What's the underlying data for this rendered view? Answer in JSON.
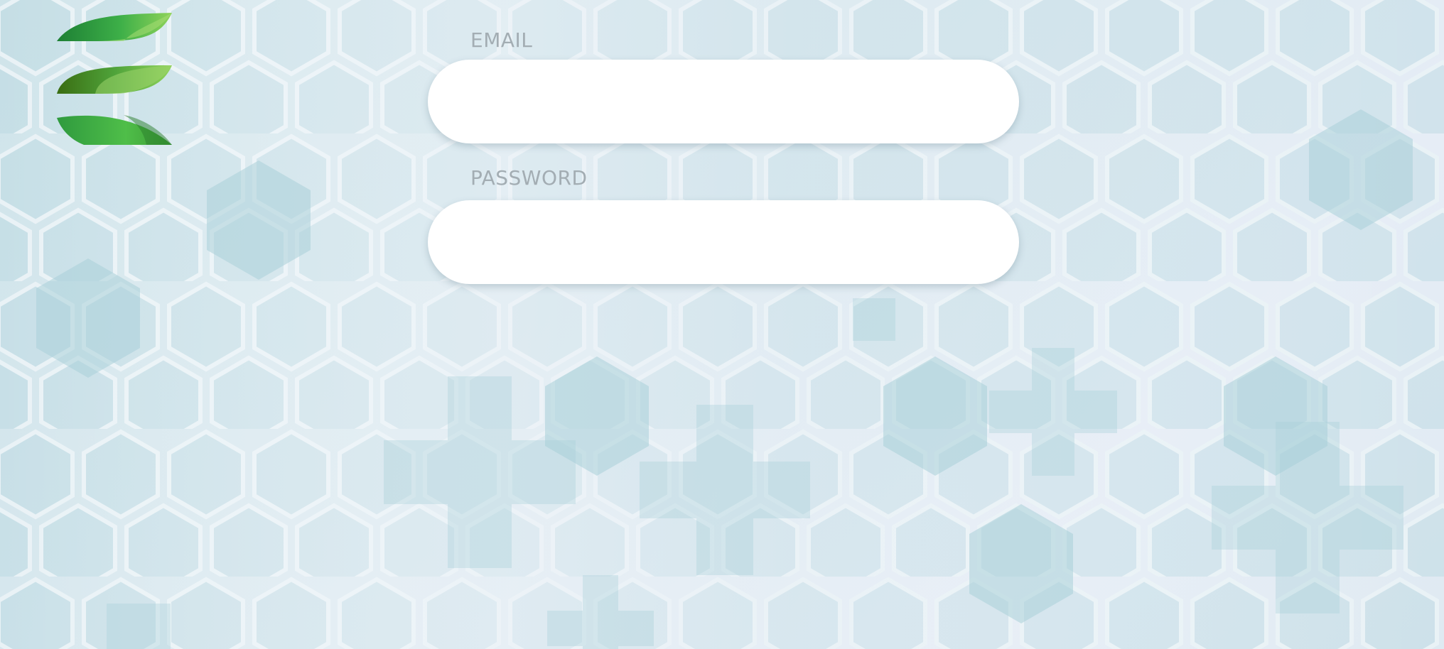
{
  "form": {
    "email_label": "EMAIL",
    "email_value": "",
    "email_placeholder": "",
    "password_label": "PASSWORD",
    "password_value": "",
    "password_placeholder": ""
  },
  "logo": {
    "icon": "stacked-leaves-logo",
    "colors": [
      "#1f8f3a",
      "#3fb64a",
      "#7fcf54",
      "#2c5e14"
    ]
  },
  "theme": {
    "background": "#d6e7ee",
    "hexagon_tint": "#b7d7df",
    "input_background": "#ffffff",
    "label_color": "#a3adb3"
  }
}
